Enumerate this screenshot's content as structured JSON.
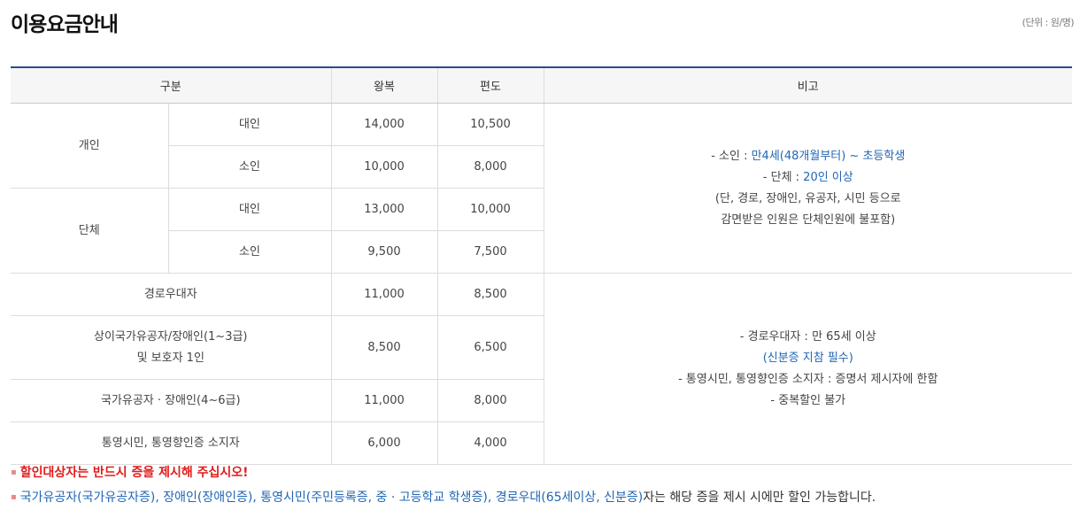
{
  "title": "이용요금안내",
  "unit": "(단위 : 원/명)",
  "table": {
    "headers": {
      "category": "구분",
      "roundtrip": "왕복",
      "oneway": "편도",
      "remarks": "비고"
    },
    "rows": [
      {
        "group": "개인",
        "sub": "대인",
        "roundtrip": "14,000",
        "oneway": "10,500"
      },
      {
        "sub": "소인",
        "roundtrip": "10,000",
        "oneway": "8,000"
      },
      {
        "group": "단체",
        "sub": "대인",
        "roundtrip": "13,000",
        "oneway": "10,000"
      },
      {
        "sub": "소인",
        "roundtrip": "9,500",
        "oneway": "7,500"
      },
      {
        "label": "경로우대자",
        "roundtrip": "11,000",
        "oneway": "8,500"
      },
      {
        "label_line1": "상이국가유공자/장애인(1~3급)",
        "label_line2": "및 보호자 1인",
        "roundtrip": "8,500",
        "oneway": "6,500"
      },
      {
        "label": "국가유공자 · 장애인(4~6급)",
        "roundtrip": "11,000",
        "oneway": "8,000"
      },
      {
        "label": "통영시민, 통영향인증 소지자",
        "roundtrip": "6,000",
        "oneway": "4,000"
      }
    ],
    "remarks1": {
      "l1_prefix": "- 소인 : ",
      "l1_value": "만4세(48개월부터) ~ 초등학생",
      "l2_prefix": "- 단체 : ",
      "l2_value": "20인 이상",
      "l3": "(단, 경로, 장애인, 유공자, 시민 등으로",
      "l4": "감면받은 인원은 단체인원에 불포함)"
    },
    "remarks2": {
      "l1": "- 경로우대자 : 만 65세 이상",
      "l2": "(신분증 지참 필수)",
      "l3": "- 통영시민, 통영향인증 소지자 : 증명서 제시자에 한함",
      "l4": "- 중복할인 불가"
    }
  },
  "notes": {
    "n1": "할인대상자는 반드시 증을 제시해 주십시오!",
    "n2_blue": "국가유공자(국가유공자증), 장애인(장애인증), 통영시민(주민등록증, 중 · 고등학교 학생증), 경로우대(65세이상, 신분증)",
    "n2_rest": "자는 해당 증을 제시 시에만 할인 가능합니다."
  },
  "colors": {
    "header_line": "#2c4f86",
    "accent_blue": "#1f66b5",
    "warning_red": "#e21b1b"
  }
}
